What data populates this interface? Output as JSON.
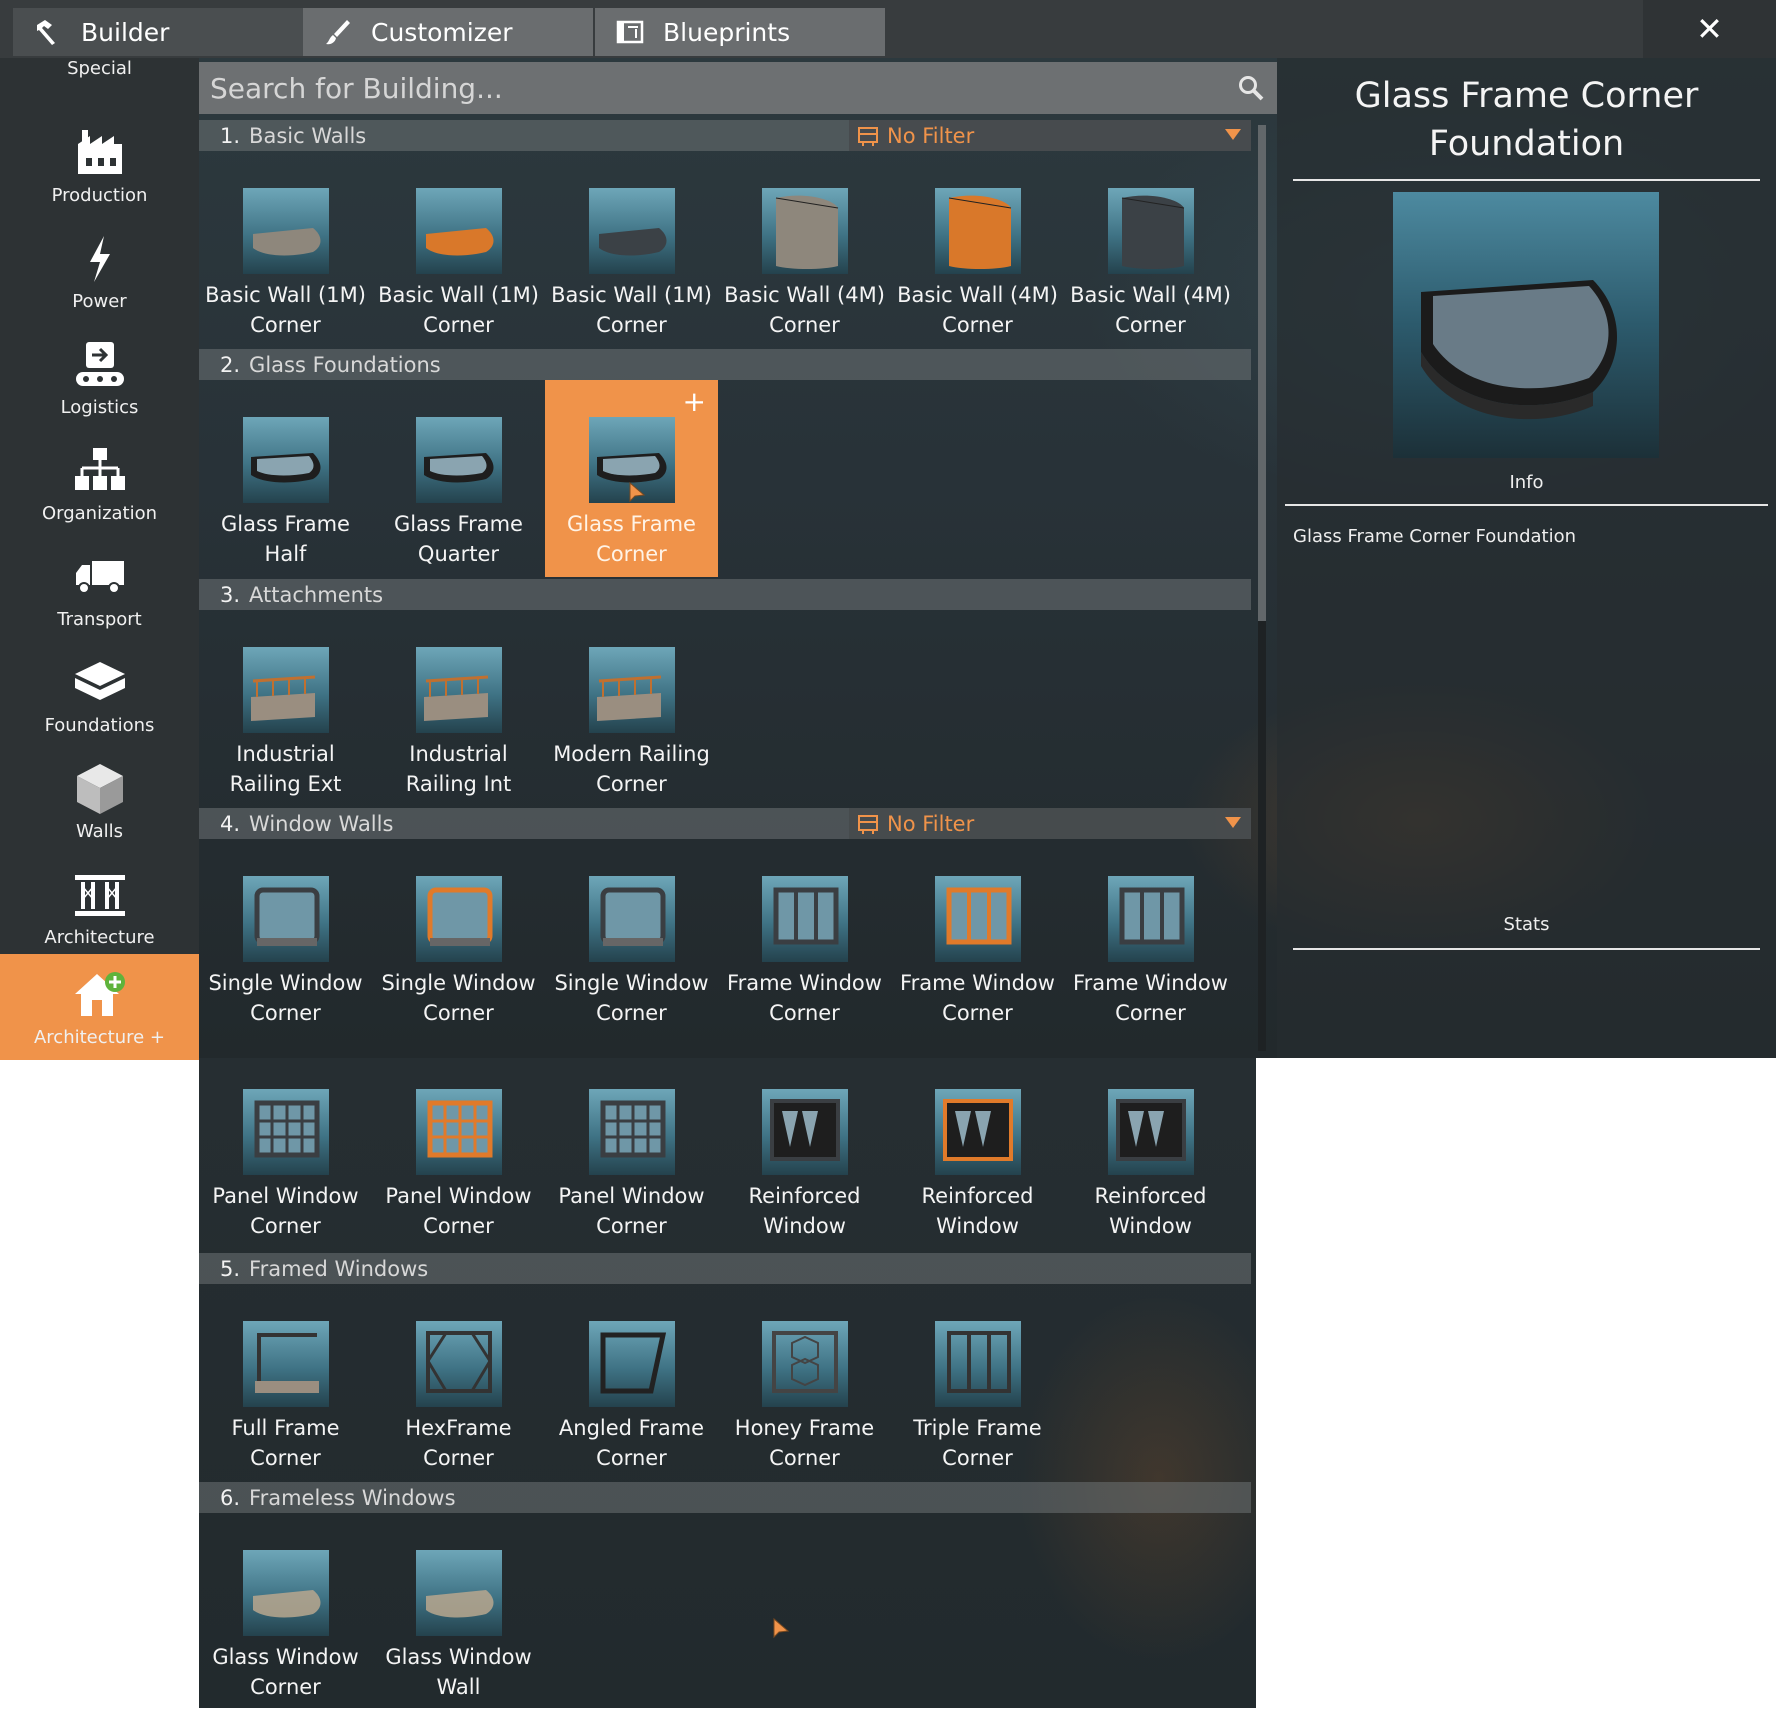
{
  "tabs": [
    {
      "label": "Builder",
      "icon": "hammer-icon"
    },
    {
      "label": "Customizer",
      "icon": "brush-icon"
    },
    {
      "label": "Blueprints",
      "icon": "blueprint-icon"
    }
  ],
  "close_label": "✕",
  "sidebar": {
    "top_label": "Special",
    "items": [
      {
        "label": "Production",
        "icon": "factory-icon"
      },
      {
        "label": "Power",
        "icon": "lightning-icon"
      },
      {
        "label": "Logistics",
        "icon": "conveyor-icon"
      },
      {
        "label": "Organization",
        "icon": "hierarchy-icon"
      },
      {
        "label": "Transport",
        "icon": "truck-icon"
      },
      {
        "label": "Foundations",
        "icon": "foundation-icon"
      },
      {
        "label": "Walls",
        "icon": "wall-cube-icon"
      },
      {
        "label": "Architecture",
        "icon": "architecture-icon"
      },
      {
        "label": "Architecture +",
        "icon": "house-plus-icon",
        "active": true
      }
    ]
  },
  "search": {
    "placeholder": "Search for Building..."
  },
  "filter_label": "No Filter",
  "sections": [
    {
      "num": "1.",
      "title": "Basic Walls",
      "filter": true,
      "items": [
        [
          "Basic Wall (1M)",
          "Corner"
        ],
        [
          "Basic Wall (1M)",
          "Corner"
        ],
        [
          "Basic Wall (1M)",
          "Corner"
        ],
        [
          "Basic Wall (4M)",
          "Corner"
        ],
        [
          "Basic Wall (4M)",
          "Corner"
        ],
        [
          "Basic Wall (4M)",
          "Corner"
        ]
      ]
    },
    {
      "num": "2.",
      "title": "Glass Foundations",
      "filter": false,
      "items": [
        [
          "Glass Frame",
          "Half"
        ],
        [
          "Glass Frame",
          "Quarter"
        ],
        [
          "Glass Frame",
          "Corner"
        ]
      ]
    },
    {
      "num": "3.",
      "title": "Attachments",
      "filter": false,
      "items": [
        [
          "Industrial",
          "Railing Ext"
        ],
        [
          "Industrial",
          "Railing Int"
        ],
        [
          "Modern Railing",
          "Corner"
        ]
      ]
    },
    {
      "num": "4.",
      "title": "Window Walls",
      "filter": true,
      "items": [
        [
          "Single Window",
          "Corner"
        ],
        [
          "Single Window",
          "Corner"
        ],
        [
          "Single Window",
          "Corner"
        ],
        [
          "Frame Window",
          "Corner"
        ],
        [
          "Frame Window",
          "Corner"
        ],
        [
          "Frame Window",
          "Corner"
        ],
        [
          "Panel Window",
          "Corner"
        ],
        [
          "Panel Window",
          "Corner"
        ],
        [
          "Panel Window",
          "Corner"
        ],
        [
          "Reinforced",
          "Window"
        ],
        [
          "Reinforced",
          "Window"
        ],
        [
          "Reinforced",
          "Window"
        ]
      ]
    },
    {
      "num": "5.",
      "title": "Framed Windows",
      "filter": false,
      "items": [
        [
          "Full Frame",
          "Corner"
        ],
        [
          "HexFrame",
          "Corner"
        ],
        [
          "Angled Frame",
          "Corner"
        ],
        [
          "Honey Frame",
          "Corner"
        ],
        [
          "Triple Frame",
          "Corner"
        ]
      ]
    },
    {
      "num": "6.",
      "title": "Frameless Windows",
      "filter": false,
      "items": [
        [
          "Glass Window",
          "Corner"
        ],
        [
          "Glass Window",
          "Wall"
        ]
      ]
    }
  ],
  "selected_item": "Glass Frame Corner",
  "selected_plus": "+",
  "detail": {
    "title_line1": "Glass Frame Corner",
    "title_line2": "Foundation",
    "info_label": "Info",
    "description": "Glass Frame Corner Foundation",
    "stats_label": "Stats"
  },
  "colors": {
    "accent": "#f0934a",
    "panel": "#2d3234",
    "tab": "#6a6d6f"
  }
}
